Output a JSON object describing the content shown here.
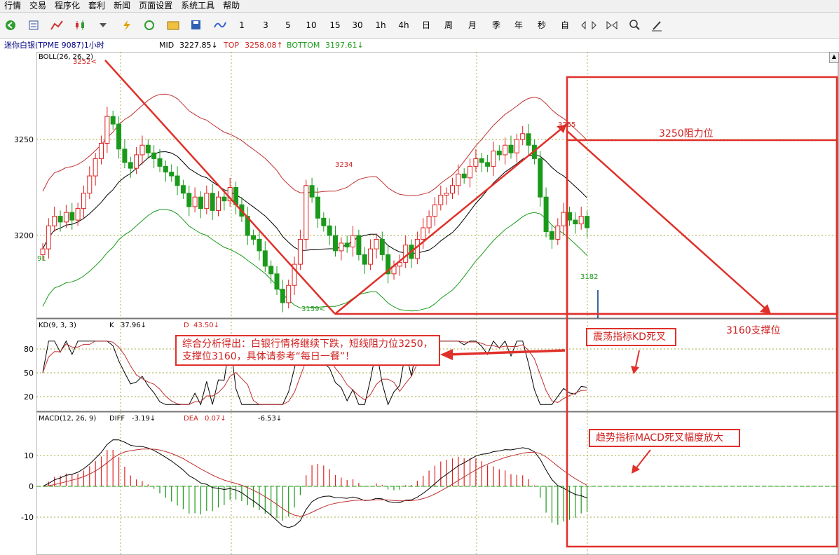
{
  "menu": [
    "行情",
    "交易",
    "程序化",
    "套利",
    "新闻",
    "页面设置",
    "系统工具",
    "帮助"
  ],
  "toolbar": {
    "periods": [
      "1",
      "3",
      "5",
      "10",
      "15",
      "30",
      "1h",
      "4h",
      "日",
      "周",
      "月",
      "季",
      "年",
      "秒",
      "自"
    ]
  },
  "instrument": {
    "title": "迷你白银(TPME 9087)1小时"
  },
  "boll_header": {
    "mid_label": "MID",
    "mid_value": "3227.85↓",
    "top_label": "TOP",
    "top_value": "3258.08↑",
    "bottom_label": "BOTTOM",
    "bottom_value": "3197.61↓",
    "indicator": "BOLL(26, 26, 2)"
  },
  "price_axis": {
    "ticks": [
      "3250",
      "3200"
    ],
    "partial_label": "91"
  },
  "price_annotations": {
    "high1": "3252<",
    "low1": "3159<",
    "high2": "3234",
    "high3": "3265",
    "low2": "3182"
  },
  "kd": {
    "title": "KD(9, 3, 3)",
    "k_label": "K",
    "k_value": "37.96↓",
    "d_label": "D",
    "d_value": "43.50↓",
    "ticks": [
      "80",
      "50",
      "20"
    ]
  },
  "macd": {
    "title": "MACD(12, 26, 9)",
    "diff_label": "DIFF",
    "diff_value": "-3.19↓",
    "dea_label": "DEA",
    "dea_value": "0.07↓",
    "macd_value": "-6.53↓",
    "ticks": [
      "10",
      "0",
      "-10"
    ]
  },
  "annotations": {
    "resistance": "3250阻力位",
    "support": "3160支撑位",
    "analysis": "综合分析得出：白银行情将继续下跌，短线阻力位3250，支撑位3160，具体请参考“每日一餐”！",
    "kd_cross": "震荡指标KD死叉",
    "macd_cross": "趋势指标MACD死叉幅度放大"
  },
  "colors": {
    "up": "#e02020",
    "down": "#1a9a1a",
    "annot": "#e0302a",
    "mid": "#000000",
    "grid": "#8a8a00"
  }
}
